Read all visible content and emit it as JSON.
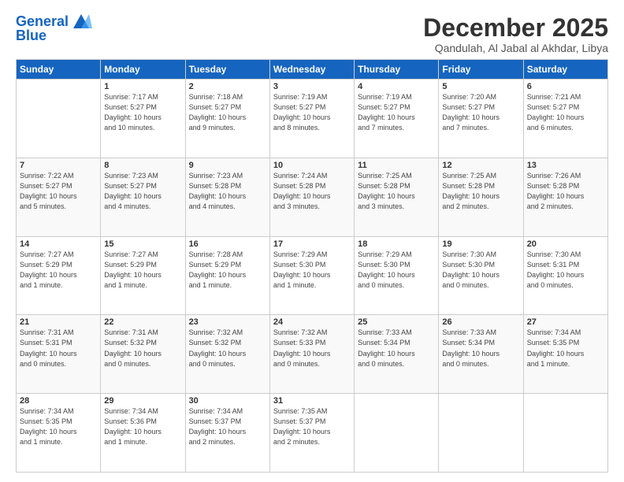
{
  "header": {
    "logo_line1": "General",
    "logo_line2": "Blue",
    "month_title": "December 2025",
    "location": "Qandulah, Al Jabal al Akhdar, Libya"
  },
  "days_of_week": [
    "Sunday",
    "Monday",
    "Tuesday",
    "Wednesday",
    "Thursday",
    "Friday",
    "Saturday"
  ],
  "weeks": [
    [
      {
        "num": "",
        "info": ""
      },
      {
        "num": "1",
        "info": "Sunrise: 7:17 AM\nSunset: 5:27 PM\nDaylight: 10 hours\nand 10 minutes."
      },
      {
        "num": "2",
        "info": "Sunrise: 7:18 AM\nSunset: 5:27 PM\nDaylight: 10 hours\nand 9 minutes."
      },
      {
        "num": "3",
        "info": "Sunrise: 7:19 AM\nSunset: 5:27 PM\nDaylight: 10 hours\nand 8 minutes."
      },
      {
        "num": "4",
        "info": "Sunrise: 7:19 AM\nSunset: 5:27 PM\nDaylight: 10 hours\nand 7 minutes."
      },
      {
        "num": "5",
        "info": "Sunrise: 7:20 AM\nSunset: 5:27 PM\nDaylight: 10 hours\nand 7 minutes."
      },
      {
        "num": "6",
        "info": "Sunrise: 7:21 AM\nSunset: 5:27 PM\nDaylight: 10 hours\nand 6 minutes."
      }
    ],
    [
      {
        "num": "7",
        "info": "Sunrise: 7:22 AM\nSunset: 5:27 PM\nDaylight: 10 hours\nand 5 minutes."
      },
      {
        "num": "8",
        "info": "Sunrise: 7:23 AM\nSunset: 5:27 PM\nDaylight: 10 hours\nand 4 minutes."
      },
      {
        "num": "9",
        "info": "Sunrise: 7:23 AM\nSunset: 5:28 PM\nDaylight: 10 hours\nand 4 minutes."
      },
      {
        "num": "10",
        "info": "Sunrise: 7:24 AM\nSunset: 5:28 PM\nDaylight: 10 hours\nand 3 minutes."
      },
      {
        "num": "11",
        "info": "Sunrise: 7:25 AM\nSunset: 5:28 PM\nDaylight: 10 hours\nand 3 minutes."
      },
      {
        "num": "12",
        "info": "Sunrise: 7:25 AM\nSunset: 5:28 PM\nDaylight: 10 hours\nand 2 minutes."
      },
      {
        "num": "13",
        "info": "Sunrise: 7:26 AM\nSunset: 5:28 PM\nDaylight: 10 hours\nand 2 minutes."
      }
    ],
    [
      {
        "num": "14",
        "info": "Sunrise: 7:27 AM\nSunset: 5:29 PM\nDaylight: 10 hours\nand 1 minute."
      },
      {
        "num": "15",
        "info": "Sunrise: 7:27 AM\nSunset: 5:29 PM\nDaylight: 10 hours\nand 1 minute."
      },
      {
        "num": "16",
        "info": "Sunrise: 7:28 AM\nSunset: 5:29 PM\nDaylight: 10 hours\nand 1 minute."
      },
      {
        "num": "17",
        "info": "Sunrise: 7:29 AM\nSunset: 5:30 PM\nDaylight: 10 hours\nand 1 minute."
      },
      {
        "num": "18",
        "info": "Sunrise: 7:29 AM\nSunset: 5:30 PM\nDaylight: 10 hours\nand 0 minutes."
      },
      {
        "num": "19",
        "info": "Sunrise: 7:30 AM\nSunset: 5:30 PM\nDaylight: 10 hours\nand 0 minutes."
      },
      {
        "num": "20",
        "info": "Sunrise: 7:30 AM\nSunset: 5:31 PM\nDaylight: 10 hours\nand 0 minutes."
      }
    ],
    [
      {
        "num": "21",
        "info": "Sunrise: 7:31 AM\nSunset: 5:31 PM\nDaylight: 10 hours\nand 0 minutes."
      },
      {
        "num": "22",
        "info": "Sunrise: 7:31 AM\nSunset: 5:32 PM\nDaylight: 10 hours\nand 0 minutes."
      },
      {
        "num": "23",
        "info": "Sunrise: 7:32 AM\nSunset: 5:32 PM\nDaylight: 10 hours\nand 0 minutes."
      },
      {
        "num": "24",
        "info": "Sunrise: 7:32 AM\nSunset: 5:33 PM\nDaylight: 10 hours\nand 0 minutes."
      },
      {
        "num": "25",
        "info": "Sunrise: 7:33 AM\nSunset: 5:34 PM\nDaylight: 10 hours\nand 0 minutes."
      },
      {
        "num": "26",
        "info": "Sunrise: 7:33 AM\nSunset: 5:34 PM\nDaylight: 10 hours\nand 0 minutes."
      },
      {
        "num": "27",
        "info": "Sunrise: 7:34 AM\nSunset: 5:35 PM\nDaylight: 10 hours\nand 1 minute."
      }
    ],
    [
      {
        "num": "28",
        "info": "Sunrise: 7:34 AM\nSunset: 5:35 PM\nDaylight: 10 hours\nand 1 minute."
      },
      {
        "num": "29",
        "info": "Sunrise: 7:34 AM\nSunset: 5:36 PM\nDaylight: 10 hours\nand 1 minute."
      },
      {
        "num": "30",
        "info": "Sunrise: 7:34 AM\nSunset: 5:37 PM\nDaylight: 10 hours\nand 2 minutes."
      },
      {
        "num": "31",
        "info": "Sunrise: 7:35 AM\nSunset: 5:37 PM\nDaylight: 10 hours\nand 2 minutes."
      },
      {
        "num": "",
        "info": ""
      },
      {
        "num": "",
        "info": ""
      },
      {
        "num": "",
        "info": ""
      }
    ]
  ]
}
